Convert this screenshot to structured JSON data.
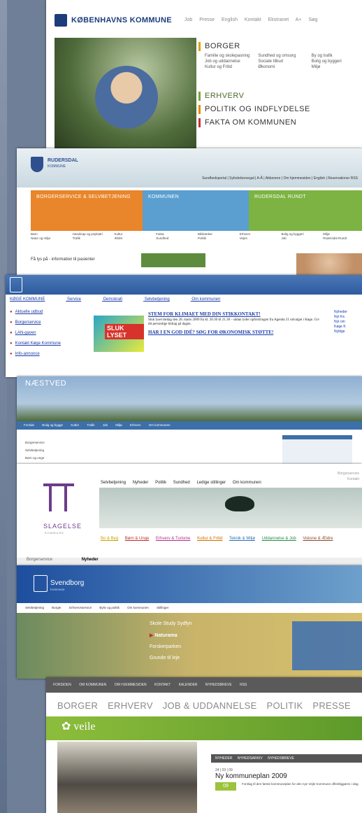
{
  "p1": {
    "brand": "KØBENHAVNS KOMMUNE",
    "topnav": [
      "Job",
      "Presse",
      "English",
      "Kontakt",
      "Ekstranet",
      "A+",
      "Søg"
    ],
    "borger": "BORGER",
    "borger_links": [
      "Familie og skolepasning",
      "Sundhed og omsorg",
      "By og trafik",
      "Job og uddannelse",
      "Sociale tilbud",
      "Bolig og byggeri",
      "Kultur og Fritid",
      "Økonomi",
      "Miljø"
    ],
    "erhverv": "ERHVERV",
    "politik": "POLITIK OG INDFLYDELSE",
    "fakta": "FAKTA OM KOMMUNEN"
  },
  "p2": {
    "brand": "RUDERSDAL",
    "brand_sub": "KOMMUNE",
    "utility": "Sundhedsportal | Syfodelsrevegal | A-Å | Abbonere | Om hjemmesiden | English | Reservationer RSS",
    "col1": "BORGERSERVICE & SELVBETJENING",
    "col2": "KOMMUNEN",
    "col3": "RUDERSDAL RUNDT",
    "link_cols": [
      "Børn",
      "Handicap og psykiatri",
      "Kultur",
      "Fakta",
      "Biblioteker",
      "Erhverv",
      "Bolig og byggeri",
      "Miljø",
      "Natur og miljø",
      "Trafik",
      "Ældre",
      "Sundhed",
      "Politik",
      "Vejen",
      "Job",
      "Rudersdal Rundt"
    ],
    "bottom": "Få lys på - information til pasienter"
  },
  "p3": {
    "nav": [
      "KØGE KOMMUNE",
      "Service",
      "Demokrati",
      "Selvbetjening",
      "Om kommunen"
    ],
    "links": [
      "Aktuelle udbud",
      "Borgerservice",
      "LAN-gaven",
      "Kontakt Køge Kommune",
      "Info-annonce"
    ],
    "poster": "SLUK LYSET",
    "headline1": "STEM FOR KLIMAET MED DIN STIKKONTAKT!",
    "text1": "Sluk lyset lørdag den 28. marts 2009 fra kl. 20.30 til 21.30 – sådan lyder opfordringen fra Agenda 21 udvalget i Køge. Giv dit personlige bidrag på dagen.",
    "headline2": "HAR I EN GOD IDÉ? SØG FOR ØKONOMISK STØTTE!",
    "right": [
      "Nyheder",
      "Nyt fra",
      "Nyt om",
      "Køge K",
      "Nyttige"
    ]
  },
  "p4": {
    "brand": "NÆSTVED",
    "navbar": [
      "Forside",
      "Bolig og bygge",
      "Kultur",
      "Trafik",
      "Job",
      "Miljø",
      "Erhverv",
      "Om kommunen"
    ],
    "sidelinks": [
      "Borgerservice",
      "Selvbetjening",
      "Børn og unge"
    ]
  },
  "p5": {
    "name": "SLAGELSE",
    "kom": "KOMMUNE",
    "nav": [
      "Selvbetjening",
      "Nyheder",
      "Politik",
      "Sundhed",
      "Ledige stillinger",
      "Om kommunen"
    ],
    "cat": [
      "Bo & Byg",
      "Børn & Unge",
      "Erhverv & Turisme",
      "Kultur & Fritid",
      "Teknik & Miljø",
      "Uddannelse & Job",
      "Voksne & Ældre"
    ],
    "toprt": [
      "Borgerservice",
      "Kontakt"
    ],
    "foot_left": "Borgerservice",
    "foot_news": "Nyheder"
  },
  "p6": {
    "brand": "Svendborg",
    "brand_sub": "Kommune",
    "nav": [
      "Selvbetjening",
      "Borger",
      "Erhvervsservice",
      "Byliv og politik",
      "Om kommunen",
      "Stillinger"
    ],
    "menu": [
      "Skole Study Sydfyn",
      "Naturama",
      "Forskerparken",
      "Grunde til leje"
    ],
    "menu_selected": 1
  },
  "p7": {
    "nav": [
      "FORSIDEN",
      "OM KOMMUNEN",
      "OM HJEMMESIDEN",
      "KONTAKT",
      "KALENDER",
      "NYHEDSBREVE",
      "RSS"
    ],
    "sections": [
      "BORGER",
      "ERHVERV",
      "JOB & UDDANNELSE",
      "POLITIK",
      "PRESSE"
    ],
    "logo": "veile",
    "tabs": [
      "NYHEDER",
      "NYHEDSARKIV",
      "NYHEDSBREVE"
    ],
    "date": "24 | 03 | 09",
    "headline": "Ny kommuneplan 2009",
    "badge": "09",
    "body": "Forslag til den første kommuneplan for den nye Vejle Kommune offentliggøres i dag."
  }
}
